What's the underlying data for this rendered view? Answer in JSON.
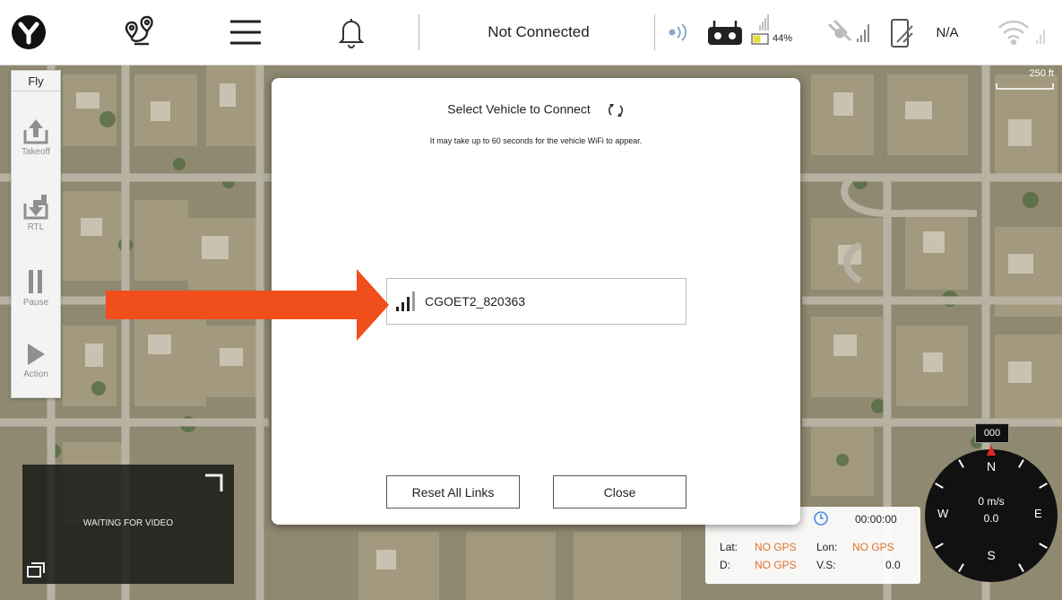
{
  "topbar": {
    "status": "Not Connected",
    "battery_percent": "44%",
    "link_value": "N/A"
  },
  "map": {
    "scale_label": "250 ft"
  },
  "toolstrip": {
    "mode_label": "Fly",
    "takeoff_label": "Takeoff",
    "rtl_label": "RTL",
    "pause_label": "Pause",
    "action_label": "Action"
  },
  "dialog": {
    "title": "Select Vehicle to Connect",
    "subtitle": "It may take up to 60 seconds for the vehicle WiFi to appear.",
    "vehicles": [
      {
        "name": "CGOET2_820363"
      }
    ],
    "reset_label": "Reset All Links",
    "close_label": "Close"
  },
  "video": {
    "status": "WAITING FOR VIDEO"
  },
  "telemetry": {
    "time": "00:00:00",
    "lat_label": "Lat:",
    "lat_value": "NO GPS",
    "lon_label": "Lon:",
    "lon_value": "NO GPS",
    "d_label": "D:",
    "d_value": "NO GPS",
    "vs_label": "V.S:",
    "vs_value": "0.0"
  },
  "compass": {
    "heading": "000",
    "speed": "0 m/s",
    "alt": "0.0",
    "n": "N",
    "s": "S",
    "e": "E",
    "w": "W"
  },
  "colors": {
    "arrow": "#f04e1a",
    "nogps": "#e0722a",
    "compass_needle": "#e02828"
  }
}
